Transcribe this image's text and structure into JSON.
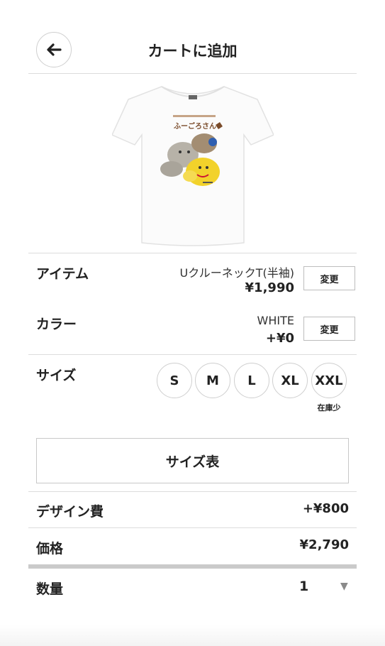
{
  "header": {
    "title": "カートに追加",
    "back_icon": "arrow-left-icon"
  },
  "product": {
    "image_alt": "T-shirt",
    "print_caption": "ふーごろさん"
  },
  "item": {
    "label": "アイテム",
    "name": "UクルーネックT(半袖)",
    "price": "¥1,990",
    "change_label": "変更"
  },
  "color": {
    "label": "カラー",
    "name": "WHITE",
    "price": "+¥0",
    "change_label": "変更"
  },
  "size": {
    "label": "サイズ",
    "options": [
      "S",
      "M",
      "L",
      "XL",
      "XXL"
    ],
    "low_stock_note": "在庫少"
  },
  "size_table": {
    "label": "サイズ表"
  },
  "design_fee": {
    "label": "デザイン費",
    "value": "+¥800"
  },
  "price": {
    "label": "価格",
    "value": "¥2,790"
  },
  "quantity": {
    "label": "数量",
    "value": "1",
    "dropdown_icon": "triangle-down-icon"
  }
}
